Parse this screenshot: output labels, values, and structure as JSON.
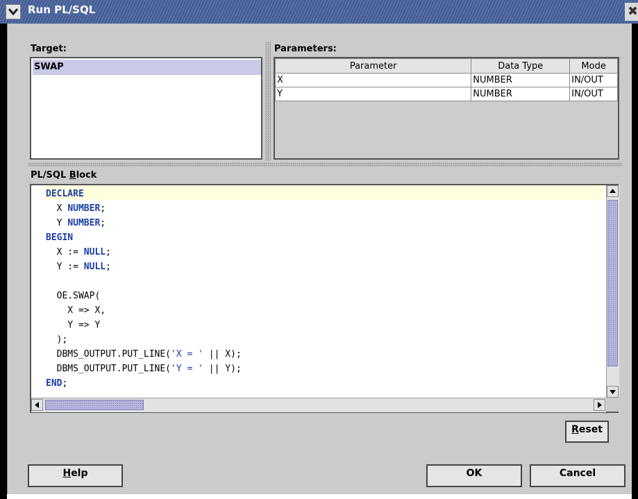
{
  "window": {
    "title": "Run PL/SQL",
    "close_glyph": "✖"
  },
  "target": {
    "label": "Target:",
    "items": [
      "SWAP"
    ]
  },
  "parameters": {
    "label": "Parameters:",
    "columns": [
      "Parameter",
      "Data Type",
      "Mode"
    ],
    "rows": [
      {
        "name": "X",
        "type": "NUMBER",
        "mode": "IN/OUT"
      },
      {
        "name": "Y",
        "type": "NUMBER",
        "mode": "IN/OUT"
      }
    ]
  },
  "block": {
    "label_pre": "PL/SQL ",
    "label_mnemonic": "B",
    "label_post": "lock"
  },
  "buttons": {
    "reset_mnemonic": "R",
    "reset_rest": "eset",
    "help_mnemonic": "H",
    "help_rest": "elp",
    "ok": "OK",
    "cancel": "Cancel"
  },
  "colors": {
    "title_bar": "#4d67a0",
    "selection": "#c9c9e8",
    "keyword": "#1a3ea6",
    "current_line": "#ffffe0"
  }
}
